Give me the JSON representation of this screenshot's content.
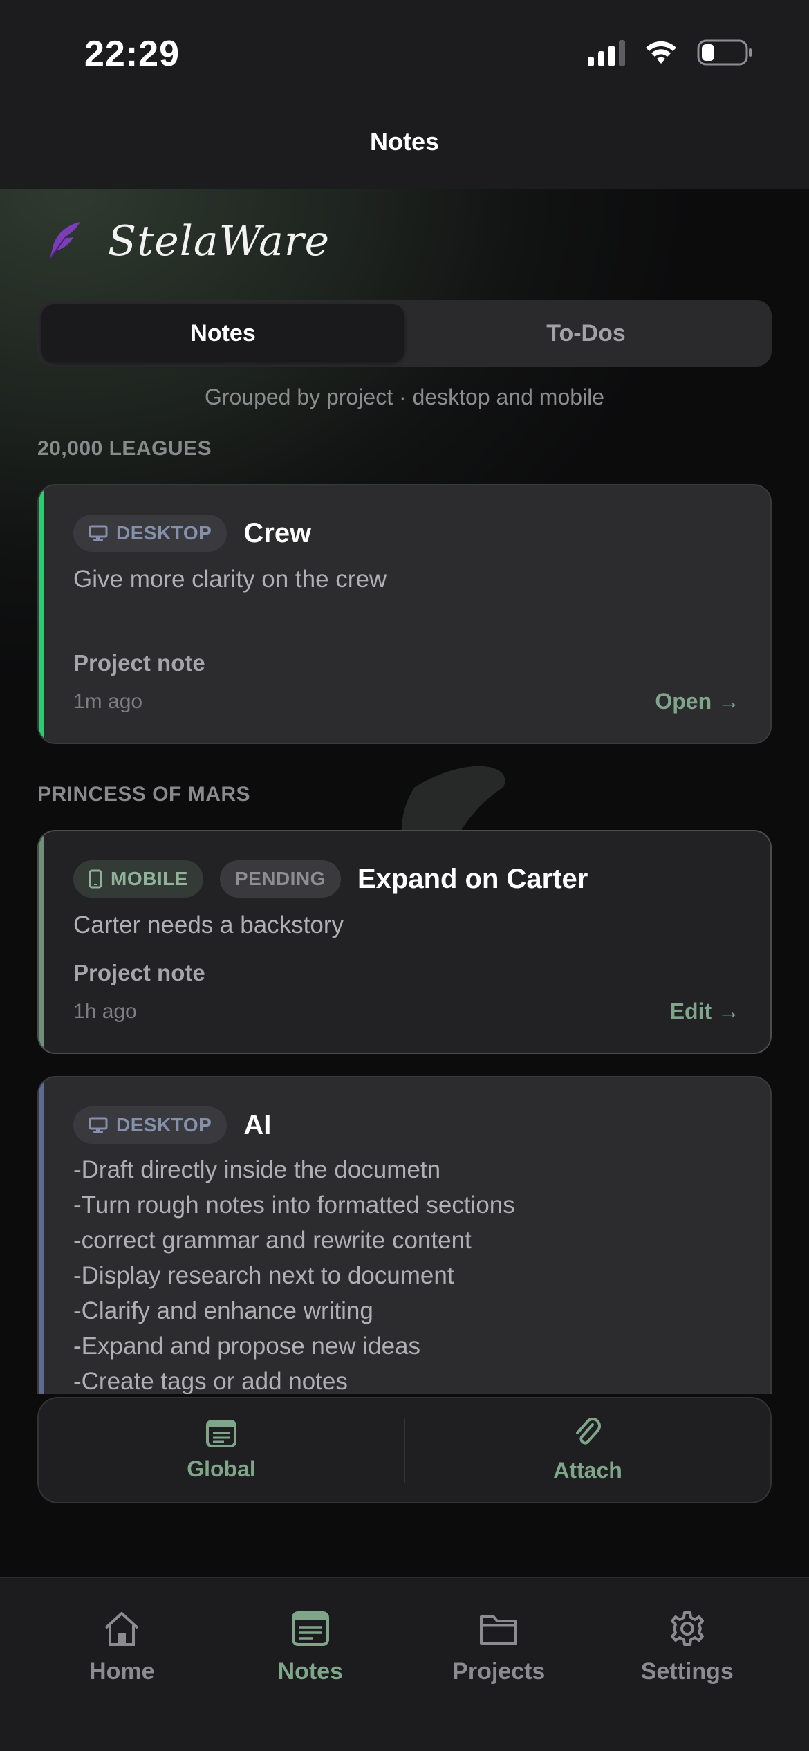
{
  "status_bar": {
    "time": "22:29",
    "signal_bars": 3,
    "battery_level": 0.25
  },
  "header": {
    "title": "Notes"
  },
  "brand": {
    "name": "StelaWare"
  },
  "segmented": {
    "notes_label": "Notes",
    "todos_label": "To-Dos",
    "active": "Notes"
  },
  "subtitle": "Grouped by project · desktop and mobile",
  "groups": [
    {
      "label": "20,000 LEAGUES",
      "cards": [
        {
          "platform": "DESKTOP",
          "title": "Crew",
          "body": "Give more clarity on the crew",
          "kind": "Project note",
          "time": "1m ago",
          "action": "Open →",
          "accent": "#2ecc71"
        }
      ]
    },
    {
      "label": "PRINCESS OF MARS",
      "cards": [
        {
          "platform": "MOBILE",
          "status": "PENDING",
          "title": "Expand on Carter",
          "body": "Carter needs a backstory",
          "kind": "Project note",
          "time": "1h ago",
          "action": "Edit →",
          "accent": "#6f8f78"
        },
        {
          "platform": "DESKTOP",
          "title": "AI",
          "body": "-Draft directly inside the documetn\n-Turn rough notes into formatted sections\n-correct grammar and rewrite content\n-Display research next to document\n-Clarify and enhance writing\n-Expand and propose new ideas\n-Create tags or add notes",
          "accent": "#5c6b8f"
        }
      ]
    }
  ],
  "action_bar": {
    "global_label": "Global",
    "attach_label": "Attach"
  },
  "tab_bar": {
    "items": [
      {
        "label": "Home",
        "icon": "home-icon"
      },
      {
        "label": "Notes",
        "icon": "notes-icon",
        "active": true
      },
      {
        "label": "Projects",
        "icon": "folder-icon"
      },
      {
        "label": "Settings",
        "icon": "gear-icon"
      }
    ]
  },
  "colors": {
    "accent_green": "#7fa68a",
    "brand_purple": "#7a3fb8"
  }
}
